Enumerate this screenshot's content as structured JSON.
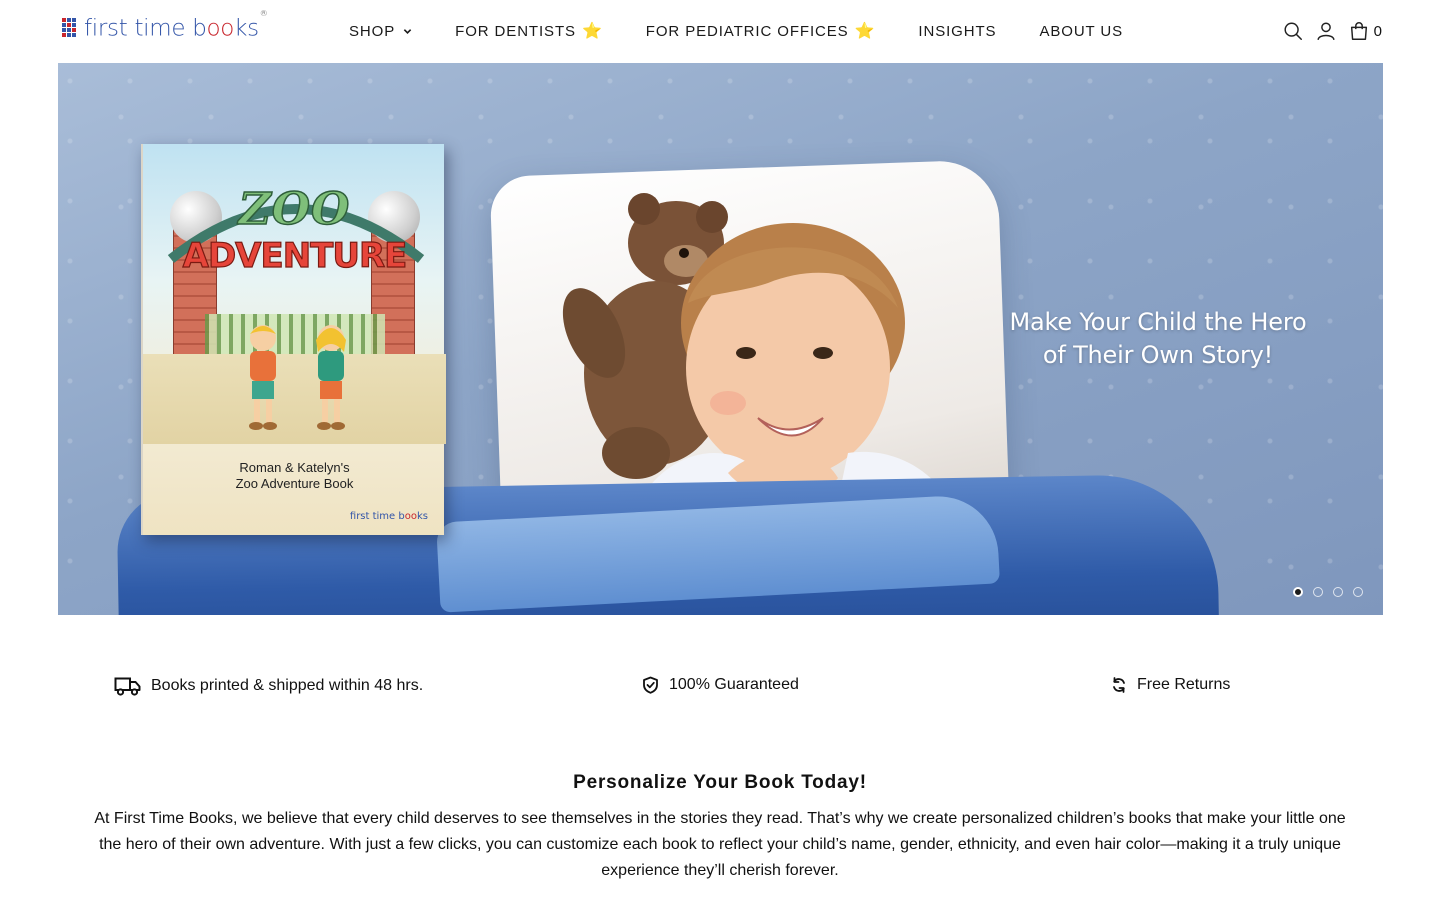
{
  "brand": {
    "logo_part1": "first time b",
    "logo_oo": "oo",
    "logo_part2": "ks",
    "logo_reg": "®",
    "colors": {
      "blue": "#3355a8",
      "red": "#c8252c",
      "star": "#f2b705"
    }
  },
  "nav": {
    "items": [
      {
        "label": "SHOP",
        "has_dropdown": true
      },
      {
        "label": "FOR DENTISTS",
        "star": "⭐"
      },
      {
        "label": "FOR PEDIATRIC OFFICES",
        "star": "⭐"
      },
      {
        "label": "INSIGHTS"
      },
      {
        "label": "ABOUT US"
      }
    ]
  },
  "header_icons": {
    "search": "search-icon",
    "account": "account-icon",
    "cart": "cart-icon",
    "cart_count": "0"
  },
  "hero": {
    "headline_line1": "Make Your Child the Hero",
    "headline_line2": "of Their Own Story!",
    "book": {
      "title_line1": "ZOO",
      "title_line2": "ADVENTURE",
      "caption_line1": "Roman & Katelyn's",
      "caption_line2": "Zoo Adventure Book",
      "logo_part1": "first time b",
      "logo_oo": "oo",
      "logo_part2": "ks"
    },
    "slides": {
      "count": 4,
      "active": 1
    }
  },
  "features": [
    {
      "icon": "truck-icon",
      "label": "Books printed & shipped within 48 hrs."
    },
    {
      "icon": "shield-check-icon",
      "label": "100% Guaranteed"
    },
    {
      "icon": "refresh-icon",
      "label": "Free Returns"
    }
  ],
  "intro": {
    "title": "Personalize Your Book Today!",
    "body": "At First Time Books, we believe that every child deserves to see themselves in the stories they read. That’s why we create personalized children’s books that make your little one the hero of their own adventure. With just a few clicks, you can customize each book to reflect your child’s name, gender, ethnicity, and even hair color—making it a truly unique experience they’ll cherish forever."
  }
}
